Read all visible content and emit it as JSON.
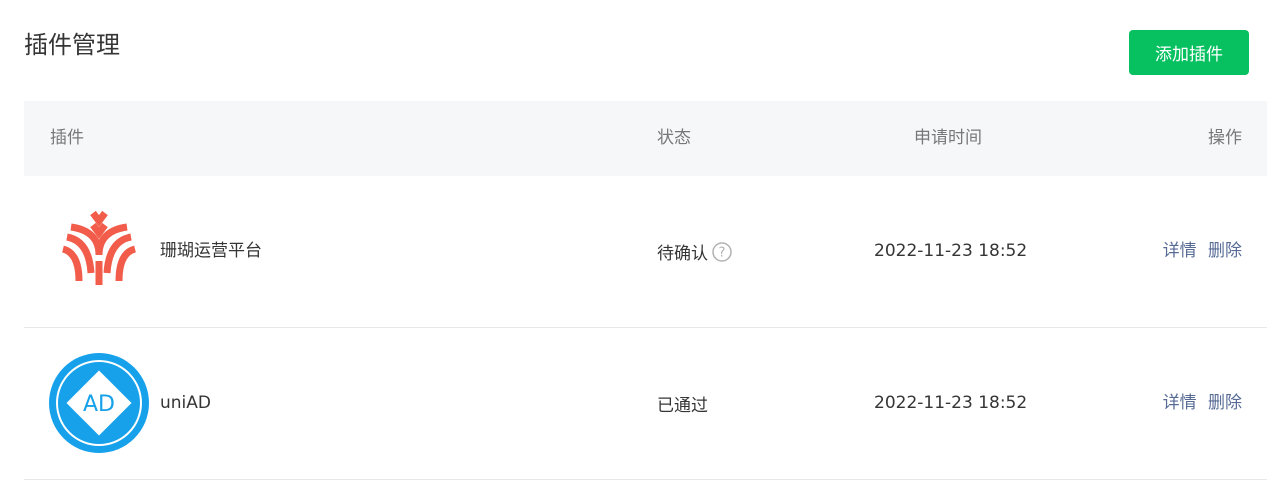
{
  "page": {
    "title": "插件管理",
    "add_button_label": "添加插件"
  },
  "table": {
    "headers": {
      "plugin": "插件",
      "status": "状态",
      "time": "申请时间",
      "action": "操作"
    },
    "rows": [
      {
        "name": "珊瑚运营平台",
        "status": "待确认",
        "show_help": true,
        "time": "2022-11-23 18:52",
        "detail_label": "详情",
        "delete_label": "删除",
        "logo": "coral-logo"
      },
      {
        "name": "uniAD",
        "status": "已通过",
        "show_help": false,
        "time": "2022-11-23 18:52",
        "detail_label": "详情",
        "delete_label": "删除",
        "logo": "uniad-logo",
        "logo_text": "AD"
      }
    ]
  },
  "colors": {
    "primary_green": "#07c160",
    "link_blue": "#576b95",
    "coral_red": "#f25c4a",
    "uniad_blue": "#16a1ea"
  }
}
